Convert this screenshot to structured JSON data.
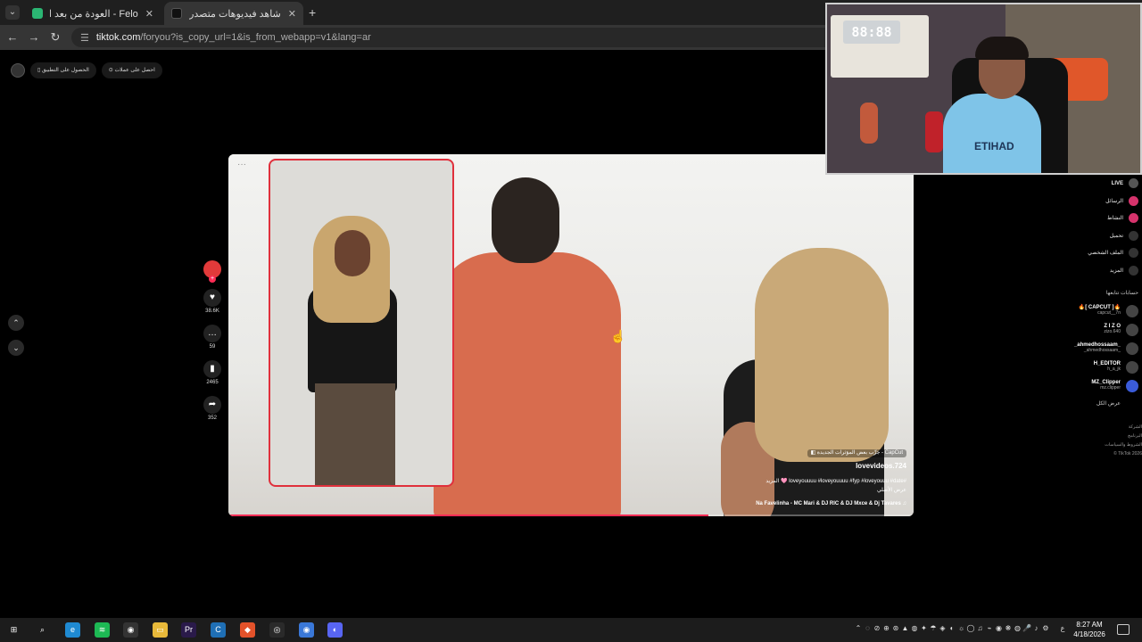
{
  "browser": {
    "tabs": [
      {
        "title": "Felo - العودة من بعد الغياب",
        "active": false,
        "favicon_color": "#2bb673"
      },
      {
        "title": "شاهد فيديوهات متصدرة | TikTok",
        "active": true,
        "favicon_color": "#111111"
      }
    ],
    "close_glyph": "✕",
    "new_tab_glyph": "+",
    "url_host": "tiktok.com",
    "url_path": "/foryou?is_copy_url=1&is_from_webapp=v1&lang=ar",
    "nav_glyphs": {
      "back": "←",
      "forward": "→",
      "reload": "↻",
      "menu": "⌄",
      "tune": "☰"
    }
  },
  "tiktok": {
    "top_pills": [
      "احصل على عملات ⊙",
      "الحصول على التطبيق ▯"
    ],
    "player": {
      "caption_ad": "CapCut - جرِّب بعض المؤثرات الجديدة ◧",
      "username": "lovevideos.724",
      "description": "#loveyouuuu #loveyouuuu #fyp #loveyouuu #date 🩷 المزيد",
      "translate": "عرض الأصلي",
      "music": "♫ Na Favelinha - MC Mari & DJ RIC & DJ Mxce & Dj Tavares",
      "progress": 0.7
    },
    "actions": [
      {
        "icon": "heart-icon",
        "glyph": "♥",
        "count": "38.6K"
      },
      {
        "icon": "comment-icon",
        "glyph": "…",
        "count": "59"
      },
      {
        "icon": "bookmark-icon",
        "glyph": "▮",
        "count": "2465"
      },
      {
        "icon": "share-icon",
        "glyph": "➦",
        "count": "352"
      }
    ],
    "nav_up": "⌃",
    "nav_down": "⌄",
    "sidebar": {
      "items": [
        {
          "label": "LIVE",
          "icon": "live-icon"
        },
        {
          "label": "الرسائل",
          "icon": "messages-icon"
        },
        {
          "label": "النشاط",
          "icon": "activity-icon"
        },
        {
          "label": "تحميل",
          "icon": "upload-icon"
        },
        {
          "label": "الملف الشخصي",
          "icon": "profile-icon"
        },
        {
          "label": "المزيد",
          "icon": "more-icon"
        }
      ],
      "following_heading": "حسابات تتابعها",
      "accounts": [
        {
          "name": "🔥[ CAPCUT ]🔥",
          "handle": "capcut__7n"
        },
        {
          "name": "Z I Z O",
          "handle": "zizo.640"
        },
        {
          "name": "_ahmedhossaam_",
          "handle": "_ahmedhossaam_"
        },
        {
          "name": "H_EDITOR",
          "handle": "h_a_jk"
        },
        {
          "name": "MZ_Clipper",
          "handle": "mz.clipper"
        }
      ],
      "see_all": "عرض الكل",
      "footer": [
        "الشركة",
        "البرنامج",
        "الشروط والسياسات",
        "TikTok 2026 ©"
      ]
    }
  },
  "webcam": {
    "clock_text": "88:88",
    "shirt_text": "ETIHAD"
  },
  "taskbar": {
    "apps": [
      {
        "name": "windows-start-icon",
        "glyph": "⊞",
        "color": "#1c1c1c"
      },
      {
        "name": "search-icon",
        "glyph": "⌕",
        "color": "#1c1c1c"
      },
      {
        "name": "edge-icon",
        "glyph": "e",
        "color": "#1f8ad2"
      },
      {
        "name": "spotify-icon",
        "glyph": "≋",
        "color": "#1db954"
      },
      {
        "name": "app-dark-icon",
        "glyph": "◉",
        "color": "#333333"
      },
      {
        "name": "file-explorer-icon",
        "glyph": "▭",
        "color": "#e8b93a"
      },
      {
        "name": "premiere-pro-icon",
        "glyph": "Pr",
        "color": "#2a1a4a"
      },
      {
        "name": "capcut-icon",
        "glyph": "C",
        "color": "#1f6fb5"
      },
      {
        "name": "brave-icon",
        "glyph": "◆",
        "color": "#e3522a"
      },
      {
        "name": "obs-icon",
        "glyph": "◎",
        "color": "#2a2a2a"
      },
      {
        "name": "chrome-icon",
        "glyph": "◉",
        "color": "#3a78d8"
      },
      {
        "name": "discord-icon",
        "glyph": "◐",
        "color": "#5865f2"
      }
    ],
    "tray_glyphs": [
      "⌃",
      "◌",
      "⊘",
      "⊕",
      "⊛",
      "▲",
      "◍",
      "✦",
      "☂",
      "◈",
      "◐",
      "☼",
      "◯",
      "♫",
      "⌁",
      "◉",
      "❋",
      "◍",
      "🎤",
      "♪",
      "⚙"
    ],
    "lang": "ع",
    "time": "8:27 AM",
    "date": "4/18/2026"
  }
}
